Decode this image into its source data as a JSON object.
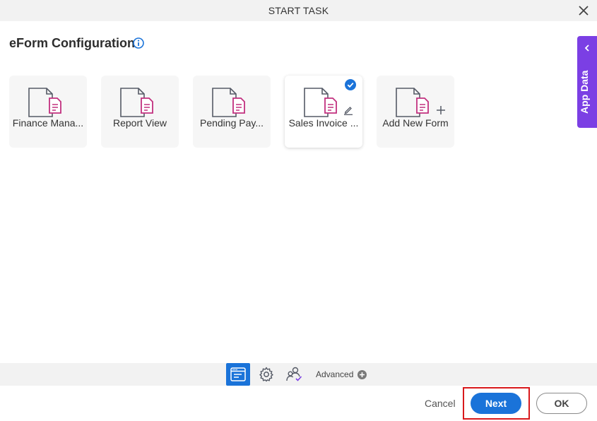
{
  "dialog": {
    "title": "START TASK"
  },
  "heading": "eForm Configuration",
  "side_tab": {
    "label": "App Data"
  },
  "forms": [
    {
      "label": "Finance Mana...",
      "selected": false
    },
    {
      "label": "Report View",
      "selected": false
    },
    {
      "label": "Pending Pay...",
      "selected": false
    },
    {
      "label": "Sales Invoice ...",
      "selected": true
    },
    {
      "label": "Add New Form",
      "selected": false
    }
  ],
  "bottom_tabs": {
    "advanced_label": "Advanced"
  },
  "footer": {
    "cancel_label": "Cancel",
    "next_label": "Next",
    "ok_label": "OK"
  },
  "colors": {
    "accent": "#1a73d9",
    "side_tab": "#7b3fe4",
    "doc_icon": "#c2307f",
    "highlight": "#d9191c"
  }
}
